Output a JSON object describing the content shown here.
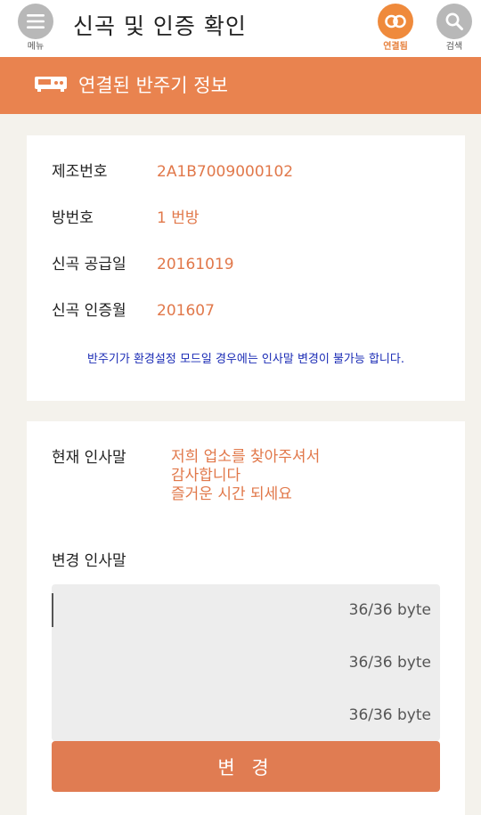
{
  "header": {
    "title": "신곡 및 인증 확인",
    "menu_label": "메뉴",
    "linked_label": "연결됨",
    "search_label": "검색"
  },
  "section": {
    "title": "연결된 반주기 정보"
  },
  "info": {
    "rows": [
      {
        "label": "제조번호",
        "value": "2A1B7009000102"
      },
      {
        "label": "방번호",
        "value": "1 번방"
      },
      {
        "label": "신곡 공급일",
        "value": "20161019"
      },
      {
        "label": "신곡 인증월",
        "value": "201607"
      }
    ],
    "notice": "반주기가 환경설정 모드일 경우에는 인사말 변경이 불가능 합니다."
  },
  "greeting": {
    "current_label": "현재 인사말",
    "current_lines": [
      "저희 업소를 찾아주셔서",
      "감사합니다",
      "즐거운 시간 되세요"
    ],
    "change_label": "변경 인사말",
    "byte_counts": [
      "36/36 byte",
      "36/36 byte",
      "36/36 byte"
    ],
    "submit_label": "변 경"
  },
  "colors": {
    "accent": "#e9834f",
    "value_text": "#e1784a",
    "notice_text": "#1a2bb5",
    "linked_icon": "#ef8a3c"
  }
}
